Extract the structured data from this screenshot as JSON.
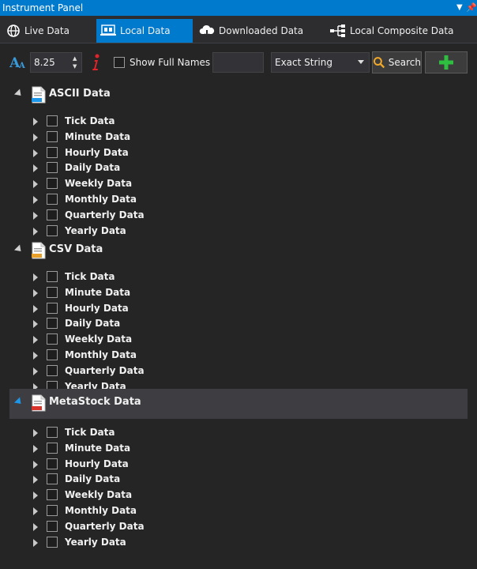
{
  "window": {
    "title": "Instrument Panel"
  },
  "tabs": [
    {
      "label": "Live Data",
      "icon": "globe-icon",
      "active": false
    },
    {
      "label": "Local Data",
      "icon": "local-data-icon",
      "active": true
    },
    {
      "label": "Downloaded Data",
      "icon": "cloud-download-icon",
      "active": false
    },
    {
      "label": "Local Composite Data",
      "icon": "composite-icon",
      "active": false
    }
  ],
  "toolbar": {
    "font_size": "8.25",
    "show_full_names_label": "Show Full Names",
    "match_mode": "Exact String",
    "search_label": "Search",
    "accent_add": "#2fbf40",
    "accent_info": "#e2232a"
  },
  "groups": [
    {
      "label": "ASCII Data",
      "icon": "ascii-file-icon",
      "selected": false,
      "items": [
        "Tick Data",
        "Minute Data",
        "Hourly Data",
        "Daily Data",
        "Weekly Data",
        "Monthly Data",
        "Quarterly Data",
        "Yearly Data"
      ]
    },
    {
      "label": "CSV Data",
      "icon": "csv-file-icon",
      "selected": false,
      "items": [
        "Tick Data",
        "Minute Data",
        "Hourly Data",
        "Daily Data",
        "Weekly Data",
        "Monthly Data",
        "Quarterly Data",
        "Yearly Data"
      ]
    },
    {
      "label": "MetaStock Data",
      "icon": "metastock-file-icon",
      "selected": true,
      "items": [
        "Tick Data",
        "Minute Data",
        "Hourly Data",
        "Daily Data",
        "Weekly Data",
        "Monthly Data",
        "Quarterly Data",
        "Yearly Data"
      ]
    }
  ]
}
